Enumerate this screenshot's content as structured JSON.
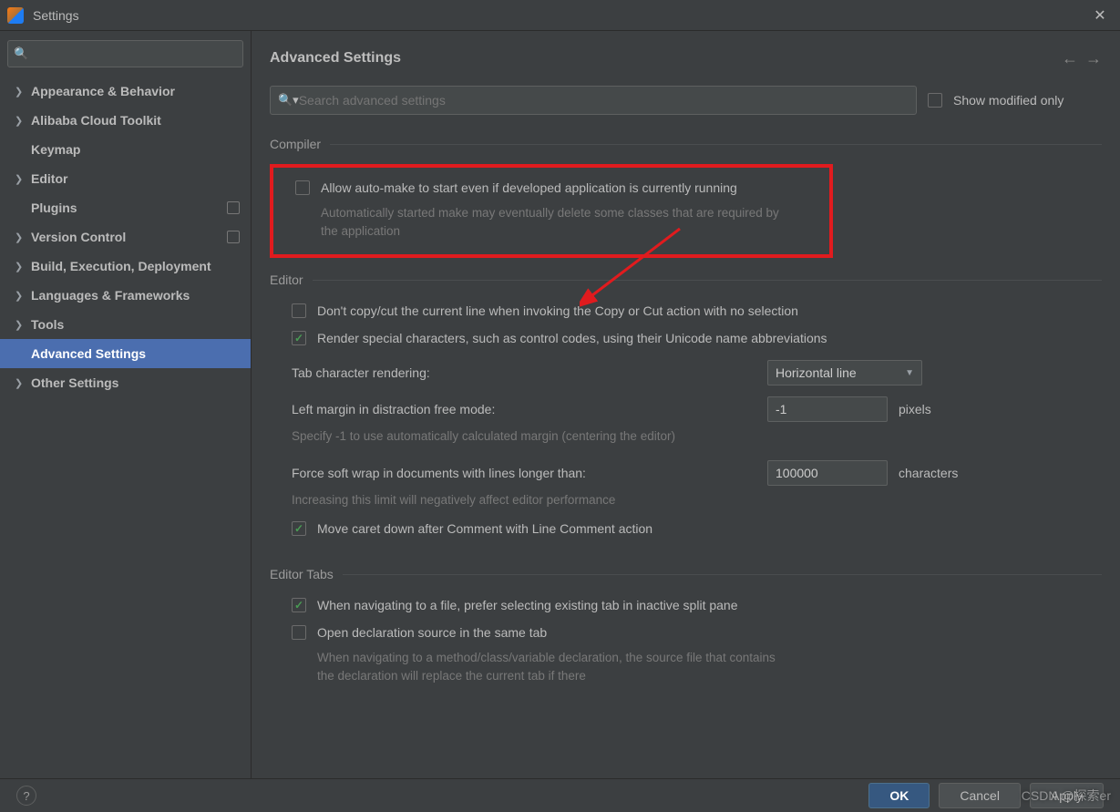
{
  "window": {
    "title": "Settings"
  },
  "sidebar": {
    "search_placeholder": "",
    "items": [
      {
        "label": "Appearance & Behavior",
        "chevron": true
      },
      {
        "label": "Alibaba Cloud Toolkit",
        "chevron": true
      },
      {
        "label": "Keymap",
        "chevron": false
      },
      {
        "label": "Editor",
        "chevron": true
      },
      {
        "label": "Plugins",
        "chevron": false,
        "badge": true
      },
      {
        "label": "Version Control",
        "chevron": true,
        "badge": true
      },
      {
        "label": "Build, Execution, Deployment",
        "chevron": true
      },
      {
        "label": "Languages & Frameworks",
        "chevron": true
      },
      {
        "label": "Tools",
        "chevron": true
      },
      {
        "label": "Advanced Settings",
        "chevron": false,
        "selected": true
      },
      {
        "label": "Other Settings",
        "chevron": true
      }
    ]
  },
  "main": {
    "title": "Advanced Settings",
    "search_placeholder": "Search advanced settings",
    "show_modified_label": "Show modified only",
    "compiler": {
      "title": "Compiler",
      "allow_automake_label": "Allow auto-make to start even if developed application is currently running",
      "allow_automake_help": "Automatically started make may eventually delete some classes that are required by the application"
    },
    "editor": {
      "title": "Editor",
      "dont_copy_cut_label": "Don't copy/cut the current line when invoking the Copy or Cut action with no selection",
      "render_special_label": "Render special characters, such as control codes, using their Unicode name abbreviations",
      "tab_render_label": "Tab character rendering:",
      "tab_render_value": "Horizontal line",
      "left_margin_label": "Left margin in distraction free mode:",
      "left_margin_value": "-1",
      "left_margin_suffix": "pixels",
      "left_margin_help": "Specify -1 to use automatically calculated margin (centering the editor)",
      "soft_wrap_label": "Force soft wrap in documents with lines longer than:",
      "soft_wrap_value": "100000",
      "soft_wrap_suffix": "characters",
      "soft_wrap_help": "Increasing this limit will negatively affect editor performance",
      "move_caret_label": "Move caret down after Comment with Line Comment action"
    },
    "editor_tabs": {
      "title": "Editor Tabs",
      "prefer_existing_label": "When navigating to a file, prefer selecting existing tab in inactive split pane",
      "open_decl_label": "Open declaration source in the same tab",
      "open_decl_help": "When navigating to a method/class/variable declaration, the source file that contains the declaration will replace the current tab if there"
    }
  },
  "footer": {
    "ok": "OK",
    "cancel": "Cancel",
    "apply": "Apply"
  },
  "watermark": "CSDN @探索er"
}
